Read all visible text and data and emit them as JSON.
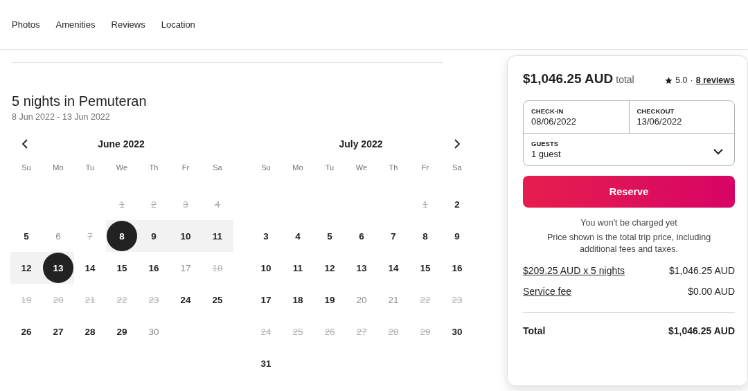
{
  "nav": [
    "Photos",
    "Amenities",
    "Reviews",
    "Location"
  ],
  "stay": {
    "title": "5 nights in Pemuteran",
    "dates": "8 Jun 2022 - 13 Jun 2022"
  },
  "calendars": [
    {
      "month": "June 2022",
      "weekdays": [
        "Su",
        "Mo",
        "Tu",
        "We",
        "Th",
        "Fr",
        "Sa"
      ],
      "weeks": [
        [
          {
            "kind": "blank"
          },
          {
            "kind": "blank"
          },
          {
            "kind": "blank"
          },
          {
            "day": "1",
            "kind": "blocked",
            "selected": false
          },
          {
            "day": "2",
            "kind": "blocked",
            "selected": false
          },
          {
            "day": "3",
            "kind": "blocked",
            "selected": false
          },
          {
            "day": "4",
            "kind": "blocked",
            "selected": false
          }
        ],
        [
          {
            "day": "5",
            "kind": "available",
            "selected": false
          },
          {
            "day": "6",
            "kind": "faded",
            "selected": false
          },
          {
            "day": "7",
            "kind": "blocked",
            "selected": false
          },
          {
            "day": "8",
            "kind": "available",
            "selected": true
          },
          {
            "day": "9",
            "kind": "available",
            "selected": false
          },
          {
            "day": "10",
            "kind": "available",
            "selected": false
          },
          {
            "day": "11",
            "kind": "available",
            "selected": false
          }
        ],
        [
          {
            "day": "12",
            "kind": "available",
            "selected": false
          },
          {
            "day": "13",
            "kind": "available",
            "selected": true
          },
          {
            "day": "14",
            "kind": "available",
            "selected": false
          },
          {
            "day": "15",
            "kind": "available",
            "selected": false
          },
          {
            "day": "16",
            "kind": "available",
            "selected": false
          },
          {
            "day": "17",
            "kind": "faded",
            "selected": false
          },
          {
            "day": "18",
            "kind": "blocked",
            "selected": false
          }
        ],
        [
          {
            "day": "19",
            "kind": "blocked",
            "selected": false
          },
          {
            "day": "20",
            "kind": "blocked",
            "selected": false
          },
          {
            "day": "21",
            "kind": "blocked",
            "selected": false
          },
          {
            "day": "22",
            "kind": "blocked",
            "selected": false
          },
          {
            "day": "23",
            "kind": "blocked",
            "selected": false
          },
          {
            "day": "24",
            "kind": "available",
            "selected": false
          },
          {
            "day": "25",
            "kind": "available",
            "selected": false
          }
        ],
        [
          {
            "day": "26",
            "kind": "available",
            "selected": false
          },
          {
            "day": "27",
            "kind": "available",
            "selected": false
          },
          {
            "day": "28",
            "kind": "available",
            "selected": false
          },
          {
            "day": "29",
            "kind": "available",
            "selected": false
          },
          {
            "day": "30",
            "kind": "faded",
            "selected": false
          }
        ]
      ]
    },
    {
      "month": "July 2022",
      "weekdays": [
        "Su",
        "Mo",
        "Tu",
        "We",
        "Th",
        "Fr",
        "Sa"
      ],
      "weeks": [
        [
          {
            "kind": "blank"
          },
          {
            "kind": "blank"
          },
          {
            "kind": "blank"
          },
          {
            "kind": "blank"
          },
          {
            "kind": "blank"
          },
          {
            "day": "1",
            "kind": "blocked",
            "selected": false
          },
          {
            "day": "2",
            "kind": "available",
            "selected": false
          }
        ],
        [
          {
            "day": "3",
            "kind": "available",
            "selected": false
          },
          {
            "day": "4",
            "kind": "available",
            "selected": false
          },
          {
            "day": "5",
            "kind": "available",
            "selected": false
          },
          {
            "day": "6",
            "kind": "available",
            "selected": false
          },
          {
            "day": "7",
            "kind": "available",
            "selected": false
          },
          {
            "day": "8",
            "kind": "available",
            "selected": false
          },
          {
            "day": "9",
            "kind": "available",
            "selected": false
          }
        ],
        [
          {
            "day": "10",
            "kind": "available",
            "selected": false
          },
          {
            "day": "11",
            "kind": "available",
            "selected": false
          },
          {
            "day": "12",
            "kind": "available",
            "selected": false
          },
          {
            "day": "13",
            "kind": "available",
            "selected": false
          },
          {
            "day": "14",
            "kind": "available",
            "selected": false
          },
          {
            "day": "15",
            "kind": "available",
            "selected": false
          },
          {
            "day": "16",
            "kind": "available",
            "selected": false
          }
        ],
        [
          {
            "day": "17",
            "kind": "available",
            "selected": false
          },
          {
            "day": "18",
            "kind": "available",
            "selected": false
          },
          {
            "day": "19",
            "kind": "available",
            "selected": false
          },
          {
            "day": "20",
            "kind": "faded",
            "selected": false
          },
          {
            "day": "21",
            "kind": "faded",
            "selected": false
          },
          {
            "day": "22",
            "kind": "blocked",
            "selected": false
          },
          {
            "day": "23",
            "kind": "blocked",
            "selected": false
          }
        ],
        [
          {
            "day": "24",
            "kind": "blocked",
            "selected": false
          },
          {
            "day": "25",
            "kind": "blocked",
            "selected": false
          },
          {
            "day": "26",
            "kind": "blocked",
            "selected": false
          },
          {
            "day": "27",
            "kind": "blocked",
            "selected": false
          },
          {
            "day": "28",
            "kind": "blocked",
            "selected": false
          },
          {
            "day": "29",
            "kind": "blocked",
            "selected": false
          },
          {
            "day": "30",
            "kind": "available",
            "selected": false
          }
        ],
        [
          {
            "day": "31",
            "kind": "available",
            "selected": false
          }
        ]
      ]
    }
  ],
  "booking": {
    "price": "$1,046.25 AUD",
    "price_suffix": "total",
    "rating": "5.0",
    "separator": "·",
    "reviews_link": "8 reviews",
    "check_in": {
      "label": "CHECK-IN",
      "value": "08/06/2022"
    },
    "checkout": {
      "label": "CHECKOUT",
      "value": "13/06/2022"
    },
    "guests": {
      "label": "GUESTS",
      "value": "1 guest"
    },
    "reserve_button": "Reserve",
    "note": "You won't be charged yet",
    "disclaimer": "Price shown is the total trip price, including additional fees and taxes.",
    "lines": [
      {
        "label": "$209.25 AUD x 5 nights",
        "amount": "$1,046.25 AUD"
      },
      {
        "label": "Service fee",
        "amount": "$0.00 AUD"
      }
    ],
    "total": {
      "label": "Total",
      "amount": "$1,046.25 AUD"
    }
  }
}
